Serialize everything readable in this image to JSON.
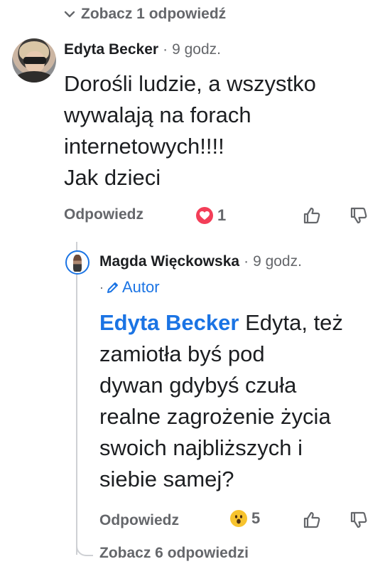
{
  "replies_toggle_top": {
    "label": "Zobacz 1 odpowiedź",
    "icon": "chevron-down-icon"
  },
  "comment": {
    "author": "Edyta Becker",
    "separator": "·",
    "time": "9 godz.",
    "lines": [
      "Dorośli ludzie, a wszystko",
      "wywalają na forach",
      "internetowych!!!!",
      "Jak dzieci"
    ],
    "reply_label": "Odpowiedz",
    "reaction": {
      "type": "heart",
      "count": "1"
    },
    "actions": {
      "like_icon": "thumbs-up-icon",
      "dislike_icon": "thumbs-down-icon"
    }
  },
  "reply": {
    "author": "Magda Więckowska",
    "separator": "·",
    "time": "9 godz.",
    "badge_separator": "·",
    "badge_label": "Autor",
    "badge_icon": "pencil-icon",
    "mention": "Edyta Becker",
    "line_first": " Edyta, też",
    "lines": [
      "zamiotła byś pod",
      "dywan gdybyś czuła",
      "realne zagrożenie życia",
      "swoich najbliższych i",
      "siebie samej?"
    ],
    "reply_label": "Odpowiedz",
    "reaction": {
      "type": "wow",
      "count": "5"
    },
    "actions": {
      "like_icon": "thumbs-up-icon",
      "dislike_icon": "thumbs-down-icon"
    }
  },
  "replies_toggle_bottom": {
    "label": "Zobacz 6 odpowiedzi"
  },
  "colors": {
    "link_blue": "#1b74e4",
    "secondary_text": "#65676b",
    "heart_red": "#f33e58"
  }
}
